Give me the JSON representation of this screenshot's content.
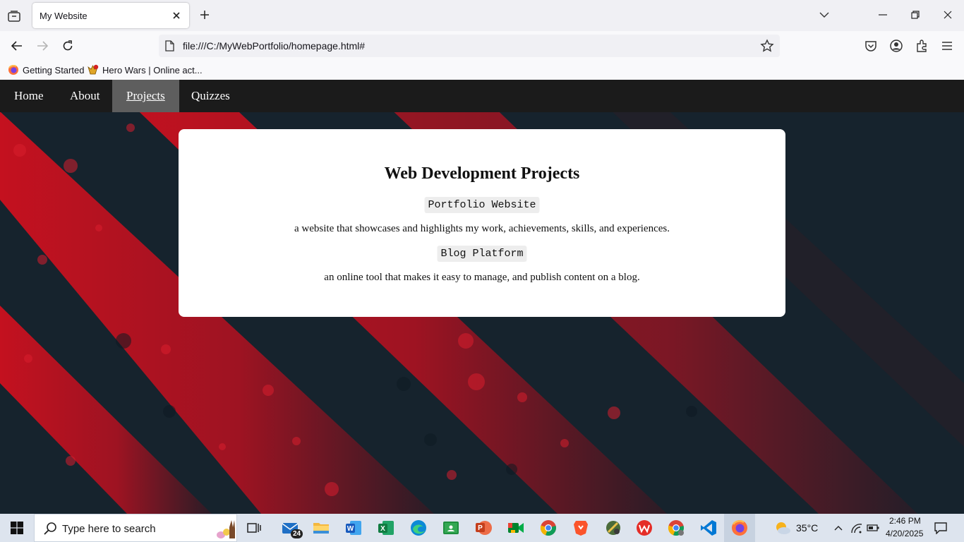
{
  "browser": {
    "tab_title": "My Website",
    "url": "file:///C:/MyWebPortfolio/homepage.html#",
    "bookmarks": [
      "Getting Started",
      "Hero Wars | Online act..."
    ]
  },
  "site": {
    "nav": [
      "Home",
      "About",
      "Projects",
      "Quizzes"
    ],
    "active_nav": "Projects",
    "heading": "Web Development Projects",
    "projects": [
      {
        "name": "Portfolio Website",
        "description": "a website that showcases and highlights my work, achievements, skills, and experiences."
      },
      {
        "name": "Blog Platform",
        "description": "an online tool that makes it easy to manage, and publish content on a blog."
      }
    ]
  },
  "taskbar": {
    "search_placeholder": "Type here to search",
    "mail_badge": "24",
    "weather": "35°C",
    "time": "2:46 PM",
    "date": "4/20/2025"
  },
  "colors": {
    "page_bg": "#16232d",
    "stripe": "#b5121f",
    "nav_bg": "#1b1b1b",
    "nav_active": "#5e5e5e"
  }
}
